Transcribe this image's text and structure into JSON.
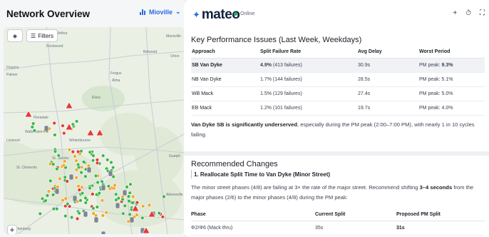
{
  "map": {
    "title": "Network Overview",
    "city": "Mioville",
    "filters_label": "Filters",
    "zoom_in": "+",
    "place_labels": [
      "Arthur",
      "Mansville",
      "Belwood",
      "Orton",
      "Rockwood",
      "Drayton",
      "Palmer",
      "Fergus",
      "Alma",
      "Elora",
      "Floradale",
      "Wallenstein",
      "Winterbourne",
      "Linwood",
      "St. Clements",
      "St. Jacobs",
      "Guelph",
      "Aikensville",
      "New Hamburg"
    ],
    "colors": {
      "green": "#3bb54a",
      "orange": "#f5a623",
      "red": "#e53935",
      "gray": "#7d8794"
    }
  },
  "app": {
    "logo": "mateo",
    "status": "Online",
    "actions": [
      "+",
      "⏱",
      "⛶"
    ]
  },
  "kpi": {
    "title": "Key Performance Issues (Last Week, Weekdays)",
    "headers": [
      "Approach",
      "Split Failure Rate",
      "Avg Delay",
      "Worst Period"
    ],
    "rows": [
      {
        "approach": "SB Van Dyke",
        "rate": "4.9%",
        "failures": "(413 failures)",
        "delay": "30.9s",
        "period": "PM peak:",
        "peak": "9.3%"
      },
      {
        "approach": "NB Van Dyke",
        "rate": "1.7%",
        "failures": "(144 failures)",
        "delay": "28.5s",
        "period": "PM peak:",
        "peak": "5.1%"
      },
      {
        "approach": "WB Mack",
        "rate": "1.5%",
        "failures": "(129 failures)",
        "delay": "27.4s",
        "period": "PM peak:",
        "peak": "5.0%"
      },
      {
        "approach": "EB Mack",
        "rate": "1.2%",
        "failures": "(101 failures)",
        "delay": "19.7s",
        "period": "PM peak:",
        "peak": "4.0%"
      }
    ],
    "summary_bold": "Van Dyke SB is significantly underserved",
    "summary_rest": ", especially during the PM peak (2:00–7:00 PM), with nearly 1 in 10 cycles failing."
  },
  "recommend": {
    "title": "Recommended Changes",
    "sub_title": "1. Reallocate Split Time to Van Dyke (Minor Street)",
    "text_1": "The minor street phases (4/8) are failing at 3× the rate of the major street. Recommend shifting ",
    "text_bold": "3–4 seconds",
    "text_2": " from the major phases (2/6) to the minor phases (4/8) during the PM peak:",
    "headers": [
      "Phase",
      "Current Split",
      "Proposed PM Split"
    ],
    "rows": [
      {
        "phase": "Φ2/Φ6 (Mack thru)",
        "current": "35s",
        "proposed": "31s"
      }
    ]
  }
}
